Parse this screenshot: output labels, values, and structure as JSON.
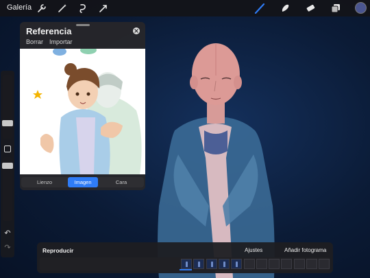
{
  "topbar": {
    "gallery_label": "Galería",
    "left_tools": [
      "wrench-icon",
      "magic-wand-icon",
      "selection-icon",
      "transform-icon"
    ],
    "right_tools": [
      "brush-icon",
      "smudge-icon",
      "eraser-icon",
      "layers-icon"
    ],
    "active_tool": "brush-icon",
    "current_color": "#4a5590"
  },
  "reference": {
    "title": "Referencia",
    "actions": [
      "Borrar",
      "Importar"
    ],
    "tabs": [
      "Lienzo",
      "Imagen",
      "Cara"
    ],
    "active_tab": "Imagen"
  },
  "animation": {
    "play_label": "Reproducir",
    "settings_label": "Ajustes",
    "add_frame_label": "Añadir fotograma",
    "frames_filled": 5,
    "frames_total": 12
  },
  "colors": {
    "accent": "#2f7cf6",
    "canvas_bg": "#0b1b36",
    "panel_bg": "#26262a"
  }
}
